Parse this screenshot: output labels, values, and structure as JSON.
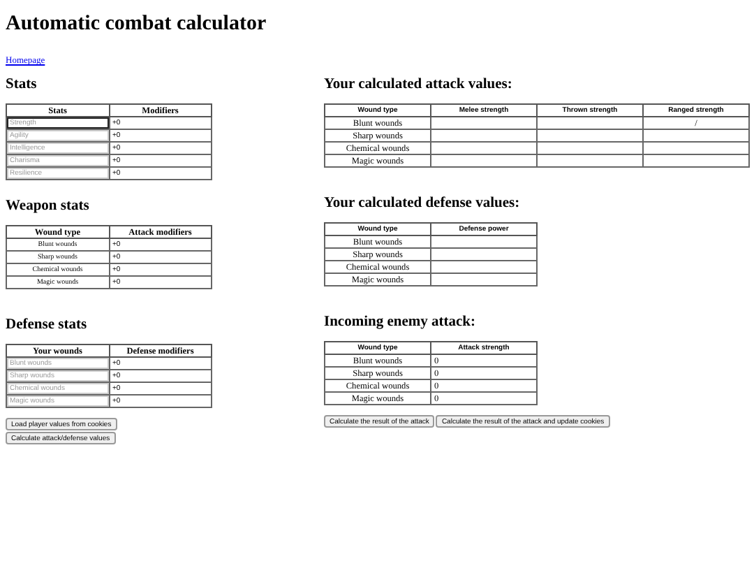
{
  "title": "Automatic combat calculator",
  "homepage_link": "Homepage",
  "stats": {
    "heading": "Stats",
    "columns": [
      "Stats",
      "Modifiers"
    ],
    "rows": [
      {
        "placeholder": "Strength",
        "focused": true,
        "modifier": "+0"
      },
      {
        "placeholder": "Agility",
        "focused": false,
        "modifier": "+0"
      },
      {
        "placeholder": "Intelligence",
        "focused": false,
        "modifier": "+0"
      },
      {
        "placeholder": "Charisma",
        "focused": false,
        "modifier": "+0"
      },
      {
        "placeholder": "Resilience",
        "focused": false,
        "modifier": "+0"
      }
    ]
  },
  "weapon_stats": {
    "heading": "Weapon stats",
    "columns": [
      "Wound type",
      "Attack modifiers"
    ],
    "rows": [
      {
        "label": "Blunt wounds",
        "modifier": "+0"
      },
      {
        "label": "Sharp wounds",
        "modifier": "+0"
      },
      {
        "label": "Chemical wounds",
        "modifier": "+0"
      },
      {
        "label": "Magic wounds",
        "modifier": "+0"
      }
    ]
  },
  "defense_stats": {
    "heading": "Defense stats",
    "columns": [
      "Your wounds",
      "Defense modifiers"
    ],
    "rows": [
      {
        "placeholder": "Blunt wounds",
        "focused": false,
        "modifier": "+0"
      },
      {
        "placeholder": "Sharp wounds",
        "focused": false,
        "modifier": "+0"
      },
      {
        "placeholder": "Chemical wounds",
        "focused": false,
        "modifier": "+0"
      },
      {
        "placeholder": "Magic wounds",
        "focused": false,
        "modifier": "+0"
      }
    ]
  },
  "left_buttons": [
    "Load player values from cookies",
    "Calculate attack/defense values"
  ],
  "attack_values": {
    "heading": "Your calculated attack values:",
    "columns": [
      "Wound type",
      "Melee strength",
      "Thrown strength",
      "Ranged strength"
    ],
    "rows": [
      {
        "cells": [
          "Blunt wounds",
          "",
          "",
          "/"
        ]
      },
      {
        "cells": [
          "Sharp wounds"
        ]
      },
      {
        "cells": [
          "Chemical wounds"
        ]
      },
      {
        "cells": [
          "Magic wounds"
        ]
      }
    ]
  },
  "defense_values": {
    "heading": "Your calculated defense values:",
    "columns": [
      "Wound type",
      "Defense power"
    ],
    "rows": [
      {
        "cells": [
          "Blunt wounds"
        ]
      },
      {
        "cells": [
          "Sharp wounds"
        ]
      },
      {
        "cells": [
          "Chemical wounds"
        ]
      },
      {
        "cells": [
          "Magic wounds"
        ]
      }
    ]
  },
  "enemy_attack": {
    "heading": "Incoming enemy attack:",
    "columns": [
      "Wound type",
      "Attack strength"
    ],
    "rows": [
      {
        "cells": [
          "Blunt wounds",
          "0"
        ]
      },
      {
        "cells": [
          "Sharp wounds",
          "0"
        ]
      },
      {
        "cells": [
          "Chemical wounds",
          "0"
        ]
      },
      {
        "cells": [
          "Magic wounds",
          "0"
        ]
      }
    ]
  },
  "right_buttons": [
    "Calculate the result of the attack",
    "Calculate the result of the attack and update cookies"
  ]
}
